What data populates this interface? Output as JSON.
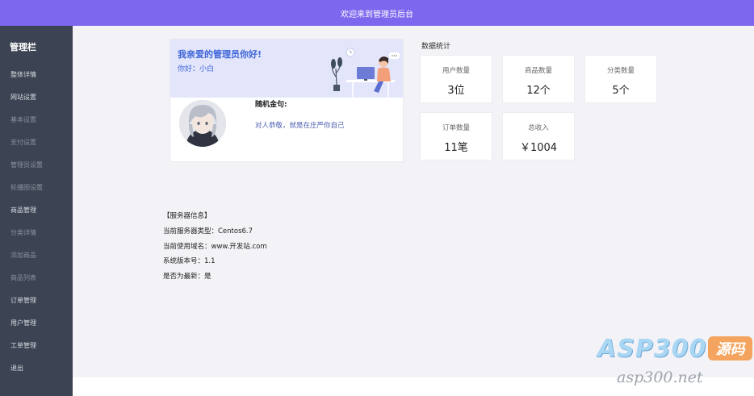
{
  "header": {
    "title": "欢迎来到管理员后台"
  },
  "sidebar": {
    "title": "管理栏",
    "items": [
      {
        "label": "整体详情"
      },
      {
        "label": "网站设置"
      },
      {
        "label": "基本设置"
      },
      {
        "label": "支付设置"
      },
      {
        "label": "管理员设置"
      },
      {
        "label": "轮播图设置"
      },
      {
        "label": "商品管理"
      },
      {
        "label": "分类详情"
      },
      {
        "label": "添加商品"
      },
      {
        "label": "商品列表"
      },
      {
        "label": "订单管理"
      },
      {
        "label": "用户管理"
      },
      {
        "label": "工单管理"
      },
      {
        "label": "退出"
      }
    ]
  },
  "welcome": {
    "title": "我亲爱的管理员你好!",
    "greeting": "你好：小白",
    "quote_title": "随机金句:",
    "quote_text": "对人恭敬，就是在庄严你自己"
  },
  "stats": {
    "heading": "数据统计",
    "items": [
      {
        "label": "用户数量",
        "value": "3位"
      },
      {
        "label": "商品数量",
        "value": "12个"
      },
      {
        "label": "分类数量",
        "value": "5个"
      },
      {
        "label": "订单数量",
        "value": "11笔"
      },
      {
        "label": "总收入",
        "value": "￥1004"
      }
    ]
  },
  "server": {
    "heading": "【服务器信息】",
    "lines": [
      "当前服务器类型：Centos6.7",
      "当前使用域名：www.开发站.com",
      "系统版本号：1.1",
      "是否为最新：是"
    ]
  },
  "watermark": {
    "brand": "ASP300",
    "badge": "源码",
    "url": "asp300.net"
  },
  "colors": {
    "topbar": "#7c67ee",
    "sidebar": "#3c4352",
    "accent": "#3d64d8"
  }
}
